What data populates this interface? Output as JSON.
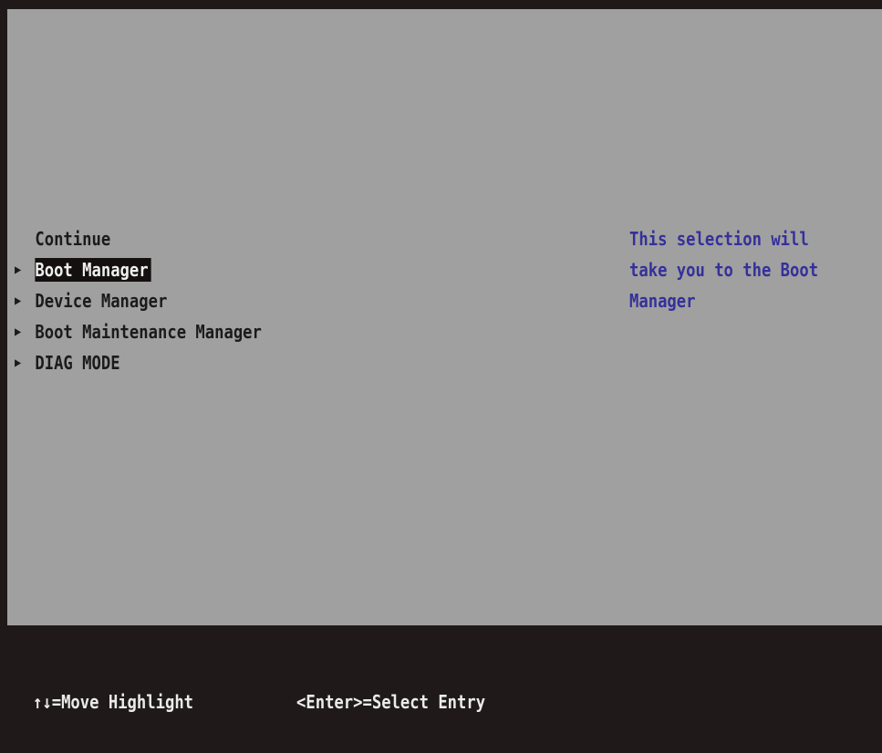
{
  "menu": {
    "items": [
      {
        "label": "Continue",
        "has_submenu": false,
        "selected": false
      },
      {
        "label": "Boot Manager",
        "has_submenu": true,
        "selected": true
      },
      {
        "label": "Device Manager",
        "has_submenu": true,
        "selected": false
      },
      {
        "label": "Boot Maintenance Manager",
        "has_submenu": true,
        "selected": false
      },
      {
        "label": "DIAG MODE",
        "has_submenu": true,
        "selected": false
      }
    ],
    "submenu_glyph": "▶"
  },
  "help": {
    "lines": [
      "This selection will",
      "take you to the Boot",
      "Manager"
    ]
  },
  "footer": {
    "move_hint": "↑↓=Move Highlight",
    "enter_hint": "<Enter>=Select Entry"
  },
  "colors": {
    "background": "#a0a0a0",
    "frame": "#1f1a19",
    "help_text": "#35309a",
    "highlight_bg": "#141010"
  }
}
